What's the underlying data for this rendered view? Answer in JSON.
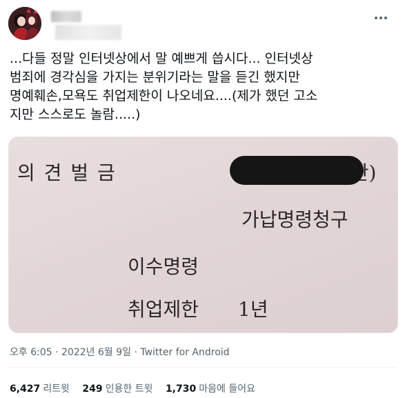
{
  "tweet": {
    "lines": [
      "...다들 정말 인터넷상에서 말 예쁘게 씁시다... 인터넷상",
      "범죄에 경각심을 가지는 분위기라는 말을 듣긴 했지만",
      "명예훼손,모욕도 취업제한이 나오네요....(제가 했던 고소",
      "지만 스스로도 놀람.....)"
    ],
    "more_icon": "ellipsis-icon"
  },
  "photo": {
    "row1_label": "의   견   벌   금",
    "row1_value_suffix": "백만)",
    "row1_value_prefix": "",
    "row2": "가납명령청구",
    "row3": "이수명령",
    "row4_label": "취업제한",
    "row4_value": "1년"
  },
  "meta": {
    "time": "오후 6:05",
    "sep1": "·",
    "date": "2022년 6월 9일",
    "sep2": "·",
    "source": "Twitter for Android"
  },
  "stats": [
    {
      "count": "6,427",
      "label": "리트윗"
    },
    {
      "count": "249",
      "label": "인용한 트윗"
    },
    {
      "count": "1,730",
      "label": "마음에 들어요"
    }
  ]
}
